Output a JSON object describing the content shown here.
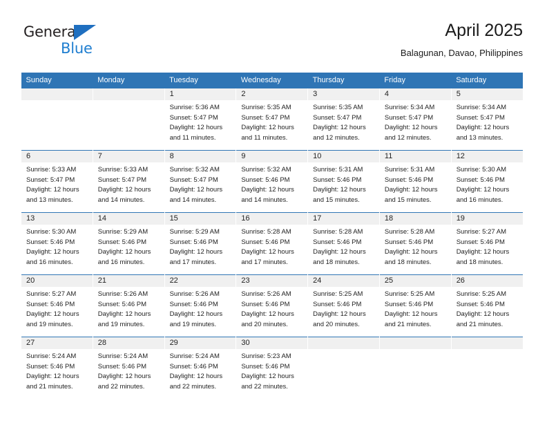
{
  "brand": {
    "name_top": "General",
    "name_bottom": "Blue",
    "triangle_color": "#1f6fc0",
    "blue_text_color": "#1f7ed0"
  },
  "header": {
    "title": "April 2025",
    "subtitle": "Balagunan, Davao, Philippines"
  },
  "theme": {
    "header_blue": "#2f75b5",
    "daynum_band": "#f0f0f0",
    "text": "#222222"
  },
  "weekdays": [
    "Sunday",
    "Monday",
    "Tuesday",
    "Wednesday",
    "Thursday",
    "Friday",
    "Saturday"
  ],
  "labels": {
    "sunrise_prefix": "Sunrise:",
    "sunset_prefix": "Sunset:",
    "daylight_prefix": "Daylight:"
  },
  "weeks": [
    [
      {
        "day": "",
        "empty": true,
        "line1": "",
        "line2": "",
        "line3": "",
        "line4": ""
      },
      {
        "day": "",
        "empty": true,
        "line1": "",
        "line2": "",
        "line3": "",
        "line4": ""
      },
      {
        "day": "1",
        "line1": "Sunrise: 5:36 AM",
        "line2": "Sunset: 5:47 PM",
        "line3": "Daylight: 12 hours",
        "line4": "and 11 minutes."
      },
      {
        "day": "2",
        "line1": "Sunrise: 5:35 AM",
        "line2": "Sunset: 5:47 PM",
        "line3": "Daylight: 12 hours",
        "line4": "and 11 minutes."
      },
      {
        "day": "3",
        "line1": "Sunrise: 5:35 AM",
        "line2": "Sunset: 5:47 PM",
        "line3": "Daylight: 12 hours",
        "line4": "and 12 minutes."
      },
      {
        "day": "4",
        "line1": "Sunrise: 5:34 AM",
        "line2": "Sunset: 5:47 PM",
        "line3": "Daylight: 12 hours",
        "line4": "and 12 minutes."
      },
      {
        "day": "5",
        "line1": "Sunrise: 5:34 AM",
        "line2": "Sunset: 5:47 PM",
        "line3": "Daylight: 12 hours",
        "line4": "and 13 minutes."
      }
    ],
    [
      {
        "day": "6",
        "line1": "Sunrise: 5:33 AM",
        "line2": "Sunset: 5:47 PM",
        "line3": "Daylight: 12 hours",
        "line4": "and 13 minutes."
      },
      {
        "day": "7",
        "line1": "Sunrise: 5:33 AM",
        "line2": "Sunset: 5:47 PM",
        "line3": "Daylight: 12 hours",
        "line4": "and 14 minutes."
      },
      {
        "day": "8",
        "line1": "Sunrise: 5:32 AM",
        "line2": "Sunset: 5:47 PM",
        "line3": "Daylight: 12 hours",
        "line4": "and 14 minutes."
      },
      {
        "day": "9",
        "line1": "Sunrise: 5:32 AM",
        "line2": "Sunset: 5:46 PM",
        "line3": "Daylight: 12 hours",
        "line4": "and 14 minutes."
      },
      {
        "day": "10",
        "line1": "Sunrise: 5:31 AM",
        "line2": "Sunset: 5:46 PM",
        "line3": "Daylight: 12 hours",
        "line4": "and 15 minutes."
      },
      {
        "day": "11",
        "line1": "Sunrise: 5:31 AM",
        "line2": "Sunset: 5:46 PM",
        "line3": "Daylight: 12 hours",
        "line4": "and 15 minutes."
      },
      {
        "day": "12",
        "line1": "Sunrise: 5:30 AM",
        "line2": "Sunset: 5:46 PM",
        "line3": "Daylight: 12 hours",
        "line4": "and 16 minutes."
      }
    ],
    [
      {
        "day": "13",
        "line1": "Sunrise: 5:30 AM",
        "line2": "Sunset: 5:46 PM",
        "line3": "Daylight: 12 hours",
        "line4": "and 16 minutes."
      },
      {
        "day": "14",
        "line1": "Sunrise: 5:29 AM",
        "line2": "Sunset: 5:46 PM",
        "line3": "Daylight: 12 hours",
        "line4": "and 16 minutes."
      },
      {
        "day": "15",
        "line1": "Sunrise: 5:29 AM",
        "line2": "Sunset: 5:46 PM",
        "line3": "Daylight: 12 hours",
        "line4": "and 17 minutes."
      },
      {
        "day": "16",
        "line1": "Sunrise: 5:28 AM",
        "line2": "Sunset: 5:46 PM",
        "line3": "Daylight: 12 hours",
        "line4": "and 17 minutes."
      },
      {
        "day": "17",
        "line1": "Sunrise: 5:28 AM",
        "line2": "Sunset: 5:46 PM",
        "line3": "Daylight: 12 hours",
        "line4": "and 18 minutes."
      },
      {
        "day": "18",
        "line1": "Sunrise: 5:28 AM",
        "line2": "Sunset: 5:46 PM",
        "line3": "Daylight: 12 hours",
        "line4": "and 18 minutes."
      },
      {
        "day": "19",
        "line1": "Sunrise: 5:27 AM",
        "line2": "Sunset: 5:46 PM",
        "line3": "Daylight: 12 hours",
        "line4": "and 18 minutes."
      }
    ],
    [
      {
        "day": "20",
        "line1": "Sunrise: 5:27 AM",
        "line2": "Sunset: 5:46 PM",
        "line3": "Daylight: 12 hours",
        "line4": "and 19 minutes."
      },
      {
        "day": "21",
        "line1": "Sunrise: 5:26 AM",
        "line2": "Sunset: 5:46 PM",
        "line3": "Daylight: 12 hours",
        "line4": "and 19 minutes."
      },
      {
        "day": "22",
        "line1": "Sunrise: 5:26 AM",
        "line2": "Sunset: 5:46 PM",
        "line3": "Daylight: 12 hours",
        "line4": "and 19 minutes."
      },
      {
        "day": "23",
        "line1": "Sunrise: 5:26 AM",
        "line2": "Sunset: 5:46 PM",
        "line3": "Daylight: 12 hours",
        "line4": "and 20 minutes."
      },
      {
        "day": "24",
        "line1": "Sunrise: 5:25 AM",
        "line2": "Sunset: 5:46 PM",
        "line3": "Daylight: 12 hours",
        "line4": "and 20 minutes."
      },
      {
        "day": "25",
        "line1": "Sunrise: 5:25 AM",
        "line2": "Sunset: 5:46 PM",
        "line3": "Daylight: 12 hours",
        "line4": "and 21 minutes."
      },
      {
        "day": "26",
        "line1": "Sunrise: 5:25 AM",
        "line2": "Sunset: 5:46 PM",
        "line3": "Daylight: 12 hours",
        "line4": "and 21 minutes."
      }
    ],
    [
      {
        "day": "27",
        "line1": "Sunrise: 5:24 AM",
        "line2": "Sunset: 5:46 PM",
        "line3": "Daylight: 12 hours",
        "line4": "and 21 minutes."
      },
      {
        "day": "28",
        "line1": "Sunrise: 5:24 AM",
        "line2": "Sunset: 5:46 PM",
        "line3": "Daylight: 12 hours",
        "line4": "and 22 minutes."
      },
      {
        "day": "29",
        "line1": "Sunrise: 5:24 AM",
        "line2": "Sunset: 5:46 PM",
        "line3": "Daylight: 12 hours",
        "line4": "and 22 minutes."
      },
      {
        "day": "30",
        "line1": "Sunrise: 5:23 AM",
        "line2": "Sunset: 5:46 PM",
        "line3": "Daylight: 12 hours",
        "line4": "and 22 minutes."
      },
      {
        "day": "",
        "empty": true,
        "line1": "",
        "line2": "",
        "line3": "",
        "line4": ""
      },
      {
        "day": "",
        "empty": true,
        "line1": "",
        "line2": "",
        "line3": "",
        "line4": ""
      },
      {
        "day": "",
        "empty": true,
        "line1": "",
        "line2": "",
        "line3": "",
        "line4": ""
      }
    ]
  ]
}
